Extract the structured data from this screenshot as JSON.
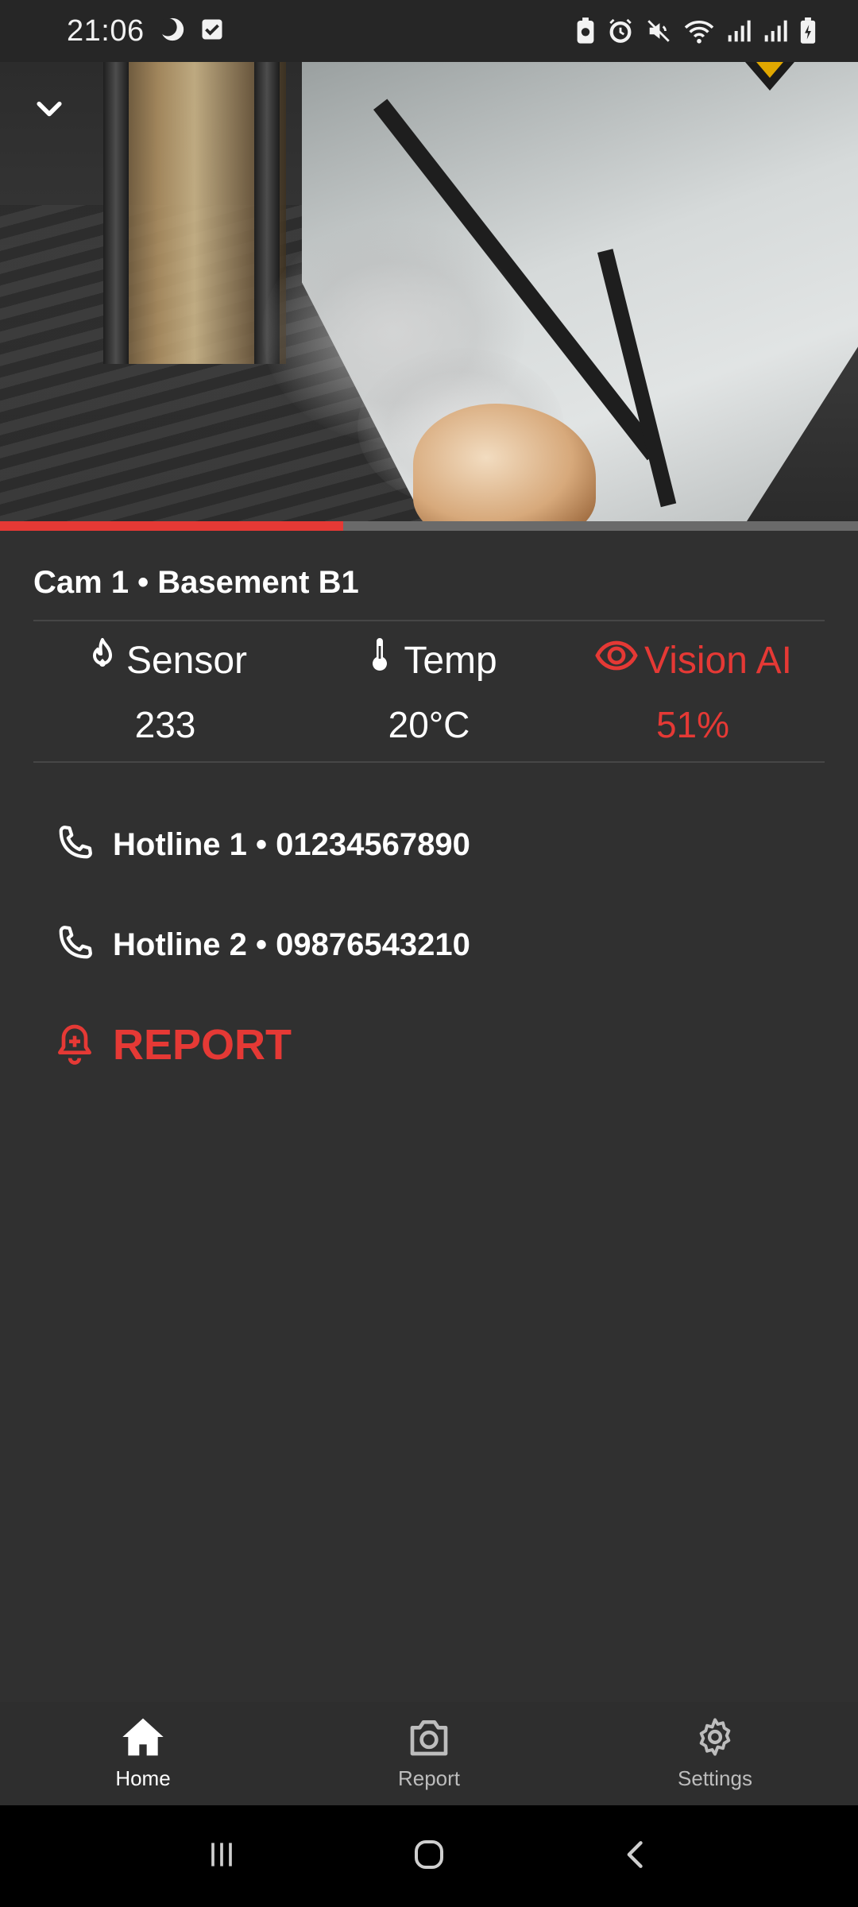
{
  "status_bar": {
    "time": "21:06",
    "left_icons": [
      "do-not-disturb-moon-icon",
      "task-checkbox-icon"
    ],
    "right_icons": [
      "battery-saver-icon",
      "alarm-icon",
      "mute-icon",
      "wifi-icon",
      "signal-sim1-icon",
      "signal-sim2-icon",
      "battery-charging-icon"
    ]
  },
  "video": {
    "collapse_icon": "chevron-down-icon",
    "progress": 0.4
  },
  "camera": {
    "title": "Cam 1 • Basement B1"
  },
  "metrics": [
    {
      "label": "Sensor",
      "value": "233",
      "icon": "flame-icon",
      "alert": false
    },
    {
      "label": "Temp",
      "value": "20°C",
      "icon": "thermometer-icon",
      "alert": false
    },
    {
      "label": "Vision AI",
      "value": "51%",
      "icon": "eye-icon",
      "alert": true
    }
  ],
  "actions": {
    "hotline1": "Hotline 1 • 01234567890",
    "hotline2": "Hotline 2 • 09876543210",
    "report": "REPORT"
  },
  "bottom_nav": [
    {
      "label": "Home",
      "icon": "home-icon",
      "active": true
    },
    {
      "label": "Report",
      "icon": "camera-icon",
      "active": false
    },
    {
      "label": "Settings",
      "icon": "gear-icon",
      "active": false
    }
  ],
  "colors": {
    "accent_red": "#e53935",
    "background": "#303030",
    "status_bar": "#262626"
  }
}
